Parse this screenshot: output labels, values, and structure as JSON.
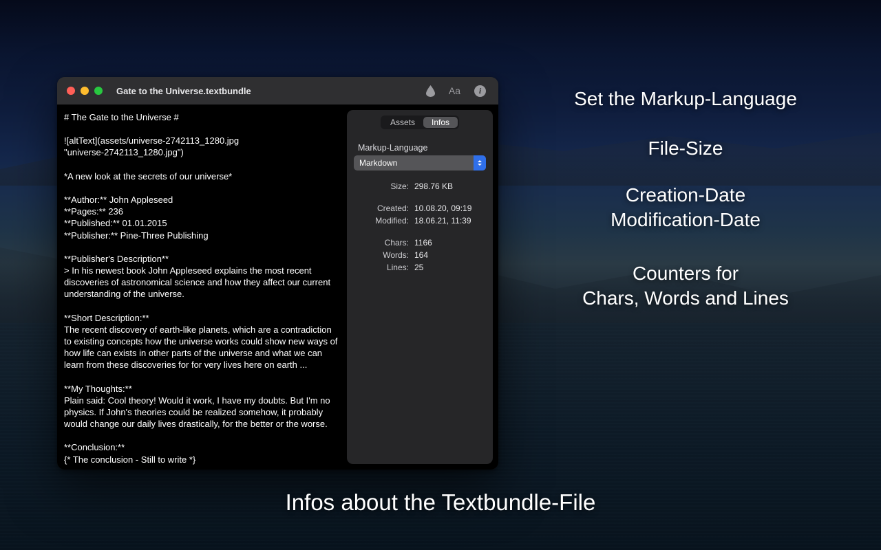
{
  "window": {
    "title": "Gate to the Universe.textbundle"
  },
  "toolbar": {
    "font_label": "Aa"
  },
  "editor": {
    "text": "# The Gate to the Universe #\n\n![altText](assets/universe-2742113_1280.jpg\n\"universe-2742113_1280.jpg\")\n\n*A new look at the secrets of our universe*\n\n**Author:** John Appleseed\n**Pages:** 236\n**Published:** 01.01.2015\n**Publisher:** Pine-Three Publishing\n\n**Publisher's Description**\n> In his newest book John Appleseed explains the most recent discoveries of astronomical science and how they affect our current understanding of the universe.\n\n**Short Description:**\nThe recent discovery of earth-like planets, which are a contradiction to existing concepts how the universe works could show new ways of how life can exists in other parts of the universe and what we can learn from these discoveries for for very lives here on earth ...\n\n**My Thoughts:**\nPlain said: Cool theory! Would it work, I have my doubts. But I'm no physics. If John's theories could be realized somehow, it probably would change our daily lives drastically, for the better or the worse.\n\n**Conclusion:**\n{* The conclusion - Still to write *}"
  },
  "sidebar": {
    "tabs": {
      "assets": "Assets",
      "infos": "Infos"
    },
    "markup_label": "Markup-Language",
    "markup_value": "Markdown",
    "rows": {
      "size_k": "Size:",
      "size_v": "298.76 KB",
      "created_k": "Created:",
      "created_v": "10.08.20, 09:19",
      "modified_k": "Modified:",
      "modified_v": "18.06.21, 11:39",
      "chars_k": "Chars:",
      "chars_v": "1166",
      "words_k": "Words:",
      "words_v": "164",
      "lines_k": "Lines:",
      "lines_v": "25"
    }
  },
  "annotations": {
    "a1": "Set the Markup-Language",
    "a2": "File-Size",
    "a3": "Creation-Date\nModification-Date",
    "a4": "Counters for\nChars, Words and Lines",
    "caption": "Infos about the Textbundle-File"
  }
}
